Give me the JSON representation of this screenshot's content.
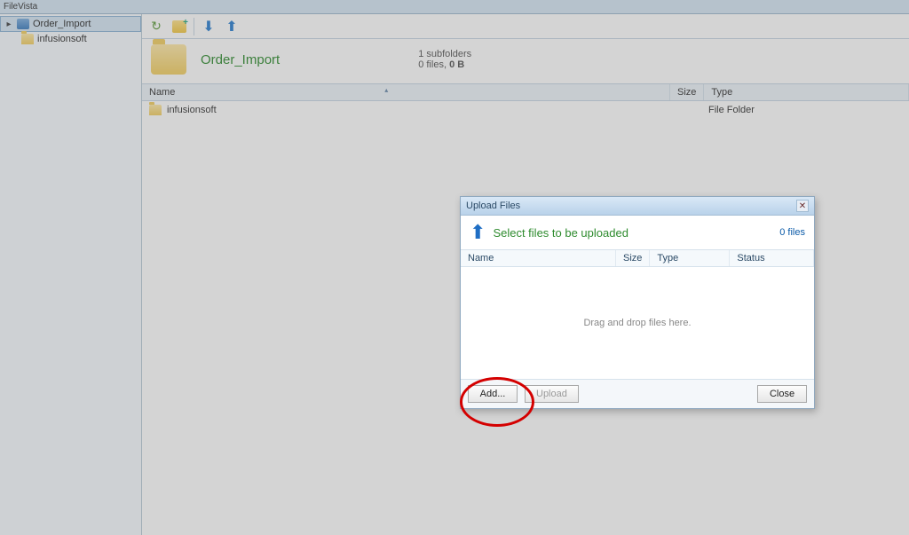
{
  "app": {
    "title": "FileVista"
  },
  "sidebar": {
    "root": {
      "label": "Order_Import"
    },
    "children": [
      {
        "label": "infusionsoft"
      }
    ]
  },
  "header": {
    "folder_name": "Order_Import",
    "subfolders_line": "1 subfolders",
    "files_line_prefix": "0 files, ",
    "files_line_bold": "0 B"
  },
  "columns": {
    "name": "Name",
    "size": "Size",
    "type": "Type"
  },
  "rows": [
    {
      "name": "infusionsoft",
      "size": "",
      "type": "File Folder"
    }
  ],
  "dialog": {
    "title": "Upload Files",
    "heading": "Select files to be uploaded",
    "count": "0 files",
    "cols": {
      "name": "Name",
      "size": "Size",
      "type": "Type",
      "status": "Status"
    },
    "drop_hint": "Drag and drop files here.",
    "buttons": {
      "add": "Add...",
      "upload": "Upload",
      "close": "Close"
    }
  }
}
